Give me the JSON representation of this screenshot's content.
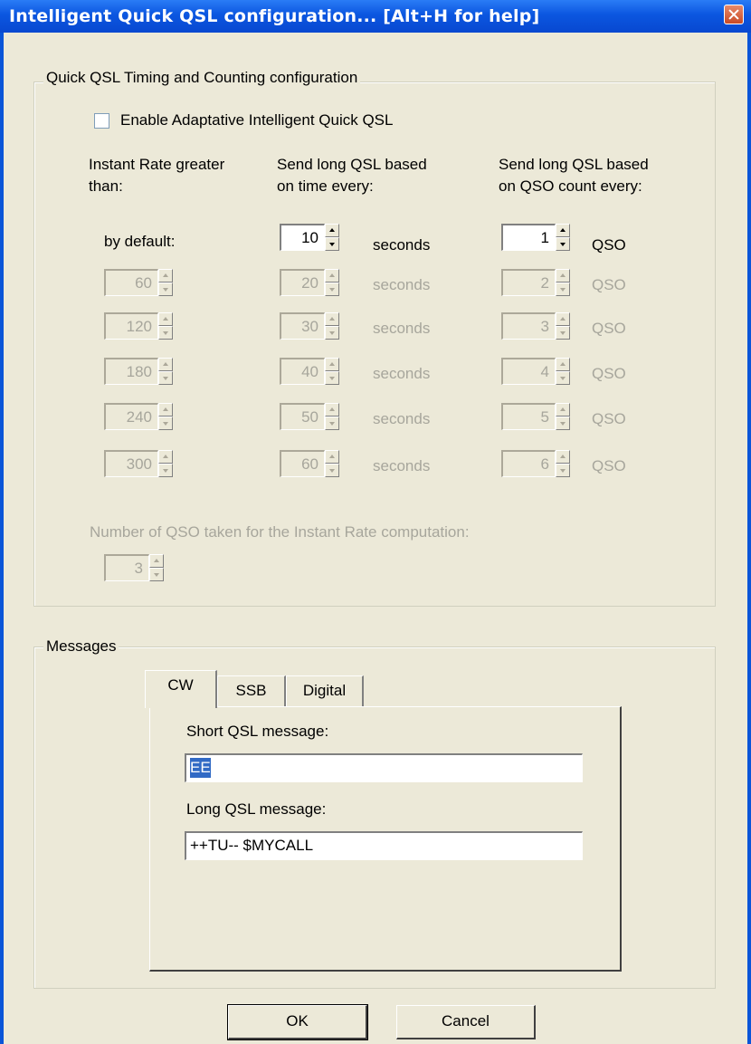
{
  "window": {
    "title": "Intelligent Quick QSL configuration... [Alt+H for help]"
  },
  "timing_group": {
    "legend": "Quick QSL Timing and Counting configuration",
    "enable_checkbox": {
      "label": "Enable Adaptative Intelligent Quick QSL",
      "checked": false
    },
    "col1_header": [
      "Instant Rate greater",
      "than:"
    ],
    "col2_header": [
      "Send long QSL based",
      "on time every:"
    ],
    "col3_header": [
      "Send long QSL based",
      "on QSO count every:"
    ],
    "default_row": {
      "label": "by default:",
      "time_value": "10",
      "time_unit": "seconds",
      "count_value": "1",
      "count_unit": "QSO"
    },
    "rows": [
      {
        "rate": "60",
        "time": "20",
        "time_unit": "seconds",
        "count": "2",
        "count_unit": "QSO"
      },
      {
        "rate": "120",
        "time": "30",
        "time_unit": "seconds",
        "count": "3",
        "count_unit": "QSO"
      },
      {
        "rate": "180",
        "time": "40",
        "time_unit": "seconds",
        "count": "4",
        "count_unit": "QSO"
      },
      {
        "rate": "240",
        "time": "50",
        "time_unit": "seconds",
        "count": "5",
        "count_unit": "QSO"
      },
      {
        "rate": "300",
        "time": "60",
        "time_unit": "seconds",
        "count": "6",
        "count_unit": "QSO"
      }
    ],
    "qso_count_label": "Number of QSO taken for the Instant Rate computation:",
    "qso_count_value": "3"
  },
  "messages_group": {
    "legend": "Messages",
    "tabs": [
      "CW",
      "SSB",
      "Digital"
    ],
    "active_tab": "CW",
    "short_label": "Short QSL message:",
    "short_value": "EE",
    "long_label": "Long QSL message:",
    "long_value": "++TU-- $MYCALL"
  },
  "buttons": {
    "ok": "OK",
    "cancel": "Cancel"
  },
  "colors": {
    "titlebar": "#0b56e0",
    "dialog_bg": "#ece9d8",
    "disabled_text": "#a7a69c",
    "selection": "#316ac5"
  }
}
